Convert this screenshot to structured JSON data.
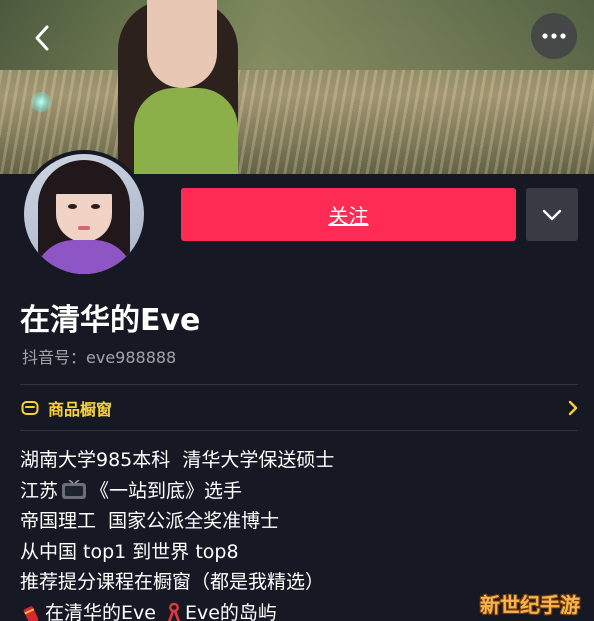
{
  "header": {
    "back_icon": "chevron-left-icon",
    "more_icon": "more-horizontal-icon"
  },
  "profile": {
    "follow_label": "关注",
    "dropdown_icon": "chevron-down-icon",
    "name": "在清华的Eve",
    "douyin_id": "抖音号：eve988888"
  },
  "shop": {
    "label": "商品橱窗",
    "icon": "shop-window-icon",
    "arrow_icon": "chevron-right-icon"
  },
  "bio": {
    "line1": "湖南大学985本科  清华大学保送硕士",
    "line2_prefix": "江苏",
    "line2_emoji": "tv-icon",
    "line2_suffix": "《一站到底》选手",
    "line3": "帝国理工  国家公派全奖准博士",
    "line4": "从中国 top1 到世界 top8",
    "line5": "推荐提分课程在橱窗（都是我精选）",
    "line6_emoji1": "firecracker-icon",
    "line6_part1": "在清华的Eve",
    "line6_emoji2": "ribbon-icon",
    "line6_part2": "Eve的岛屿"
  },
  "watermark": "新世纪手游",
  "colors": {
    "background": "#161823",
    "follow_button": "#fe2c55",
    "shop_accent": "#f9d03b"
  }
}
